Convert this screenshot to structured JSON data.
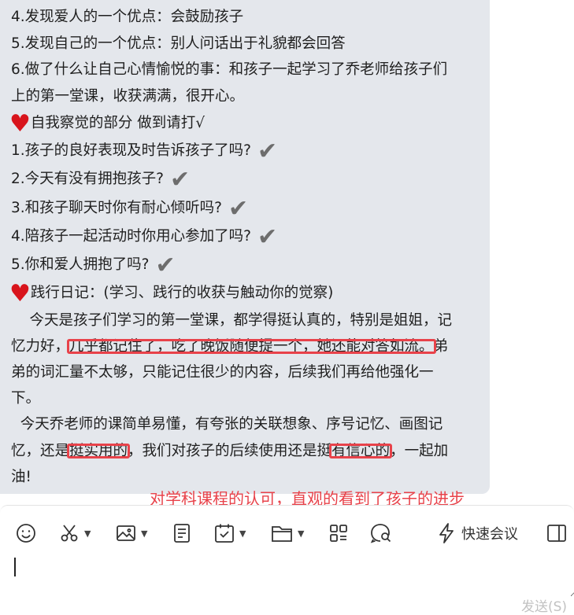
{
  "message": {
    "l01": "4.发现爱人的一个优点：会鼓励孩子",
    "l02": "5.发现自己的一个优点：别人问话出于礼貌都会回答",
    "l03": "6.做了什么让自己心情愉悦的事：和孩子一起学习了乔老师给孩子们",
    "l04": "上的第一堂课，收获满满，很开心。",
    "l05": "自我察觉的部分 做到请打√",
    "l06": "1.孩子的良好表现及时告诉孩子了吗?",
    "l07": "2.今天有没有拥抱孩子?",
    "l08": "3.和孩子聊天时你有耐心倾听吗?",
    "l09": "4.陪孩子一起活动时你用心参加了吗?",
    "l10": "5.你和爱人拥抱了吗?",
    "l11": "践行日记：(学习、践行的收获与触动你的觉察)",
    "l12": "    今天是孩子们学习的第一堂课，都学得挺认真的，特别是姐姐，记",
    "l13a": "忆力好，",
    "l13b": "几乎都记住了，吃了晚饭随便提一个，她还能对答如流。",
    "l13c": "弟",
    "l14": "弟的词汇量不太够，只能记住很少的内容，后续我们再给他强化一",
    "l15": "下。",
    "l16": "  今天乔老师的课简单易懂，有夸张的关联想象、序号记忆、画图记",
    "l17a": "忆，还是",
    "l17b": "挺实用的",
    "l17c": "，我们对孩子的后续使用还是挺",
    "l17d": "有信心的",
    "l17e": "，一起加",
    "l18": "油!"
  },
  "heart_glyph": "♥",
  "check_glyph": "✔",
  "annotation": "对学科课程的认可，直观的看到了孩子的进步",
  "toolbar": {
    "quick_meeting": "快速会议",
    "icons": [
      "emoji-icon",
      "scissors-icon",
      "image-icon",
      "document-icon",
      "calendar-check-icon",
      "folder-icon",
      "apps-icon",
      "chat-search-icon",
      "lightning-icon",
      "sidebar-icon"
    ]
  },
  "input": {
    "value": ""
  },
  "send_label": "发送(S)",
  "colors": {
    "bubble": "#e4e7ec",
    "highlight": "#e8424a",
    "heart": "#d8141c",
    "check": "#6d6d6d"
  }
}
